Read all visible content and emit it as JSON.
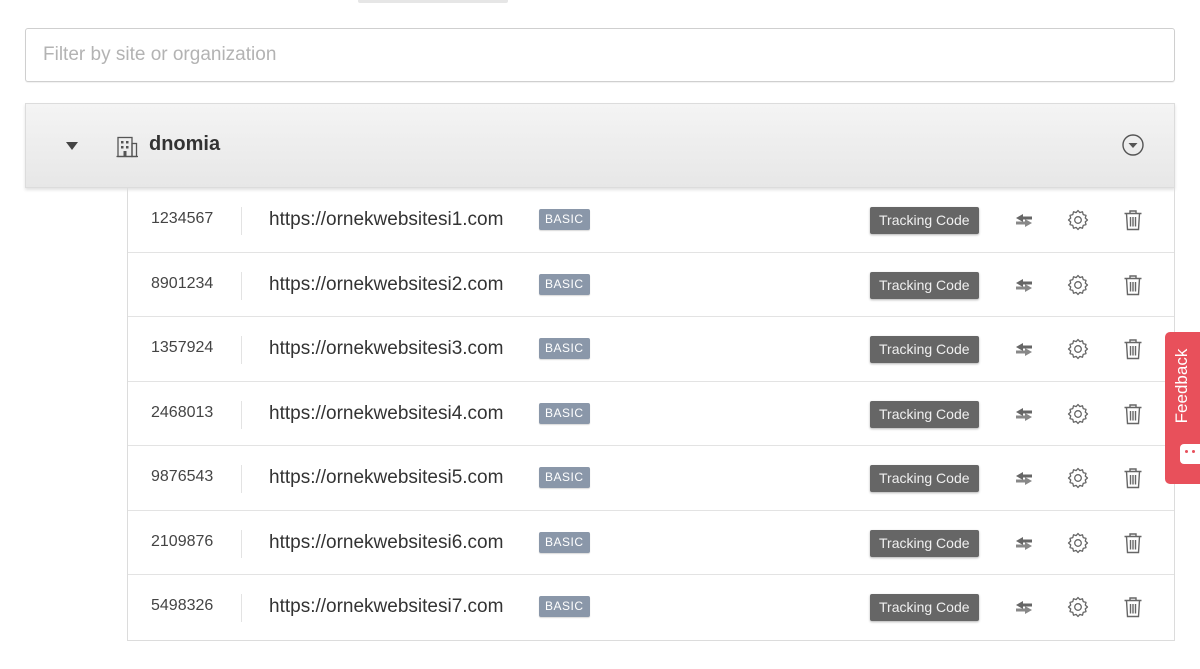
{
  "filter": {
    "placeholder": "Filter by site or organization"
  },
  "organization": {
    "name": "dnomia"
  },
  "sites": [
    {
      "id": "1234567",
      "url": "https://ornekwebsitesi1.com",
      "plan": "BASIC",
      "tracking_label": "Tracking Code"
    },
    {
      "id": "8901234",
      "url": "https://ornekwebsitesi2.com",
      "plan": "BASIC",
      "tracking_label": "Tracking Code"
    },
    {
      "id": "1357924",
      "url": "https://ornekwebsitesi3.com",
      "plan": "BASIC",
      "tracking_label": "Tracking Code"
    },
    {
      "id": "2468013",
      "url": "https://ornekwebsitesi4.com",
      "plan": "BASIC",
      "tracking_label": "Tracking Code"
    },
    {
      "id": "9876543",
      "url": "https://ornekwebsitesi5.com",
      "plan": "BASIC",
      "tracking_label": "Tracking Code"
    },
    {
      "id": "2109876",
      "url": "https://ornekwebsitesi6.com",
      "plan": "BASIC",
      "tracking_label": "Tracking Code"
    },
    {
      "id": "5498326",
      "url": "https://ornekwebsitesi7.com",
      "plan": "BASIC",
      "tracking_label": "Tracking Code"
    }
  ],
  "icons": {
    "org": "building-icon",
    "expand": "caret-down-icon",
    "org_menu": "circle-chevron-down-icon",
    "transfer": "transfer-arrows-icon",
    "settings": "gear-icon",
    "delete": "trash-icon",
    "feedback": "smiley-icon"
  },
  "feedback": {
    "label": "Feedback"
  },
  "colors": {
    "badge": "#8a97a9",
    "tracking_button": "#666666",
    "feedback": "#e8505b",
    "header_bg": "#ececec"
  }
}
